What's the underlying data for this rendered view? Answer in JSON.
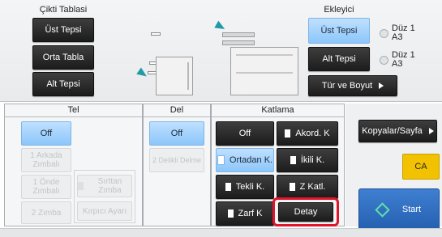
{
  "output_tray": {
    "title": "Çikti Tablasi",
    "top_tray": "Üst Tepsi",
    "middle_tray": "Orta Tabla",
    "bottom_tray": "Alt Tepsi"
  },
  "inserter": {
    "title": "Ekleyici",
    "upper_tray": "Üst Tepsi",
    "upper_tray_paper_1": "Düz 1",
    "upper_tray_paper_2": "A3",
    "lower_tray": "Alt Tepsi",
    "lower_tray_paper_1": "Düz 1",
    "lower_tray_paper_2": "A3",
    "type_size": "Tür ve Boyut"
  },
  "staple": {
    "title": "Tel",
    "off": "Off",
    "one_back": "1 Arkada Zımbalı",
    "one_front": "1 Önde Zımbalı",
    "saddle": "Sırttan Zımba",
    "two_staple": "2 Zımba",
    "stapleless": "Kırpıcı Ayarı"
  },
  "punch": {
    "title": "Del",
    "off": "Off",
    "two_hole": "2 Delikli Delme"
  },
  "fold": {
    "title": "Katlama",
    "off": "Off",
    "accordion": "Akord. K",
    "center": "Ortadan K.",
    "double": "İkili K.",
    "single": "Tekli K.",
    "z_fold": "Z Katl.",
    "envelope": "Zarf K",
    "detail": "Detay"
  },
  "side": {
    "copies_per_set": "Kopyalar/Sayfa",
    "ca": "CA",
    "start": "Start"
  }
}
